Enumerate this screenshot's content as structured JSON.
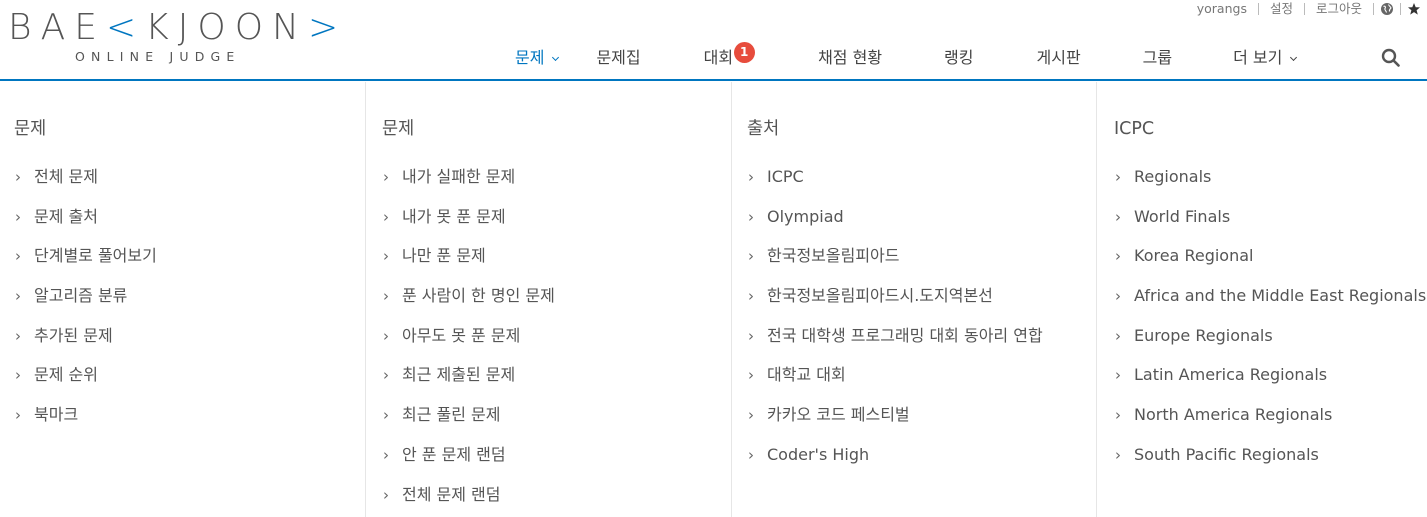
{
  "logo": {
    "top_left": "BAE",
    "top_mark": "K",
    "top_right": "JOON",
    "top_end": ">",
    "subtitle": "ONLINE JUDGE"
  },
  "topbar": {
    "username": "yorangs",
    "settings": "설정",
    "logout": "로그아웃",
    "globe_icon": "globe-icon",
    "star_icon": "star-icon"
  },
  "nav": {
    "items": [
      {
        "label": "문제",
        "active": true,
        "dropdown": true
      },
      {
        "label": "문제집"
      },
      {
        "label": "대회",
        "badge": "1"
      },
      {
        "label": "채점 현황"
      },
      {
        "label": "랭킹"
      },
      {
        "label": "게시판"
      },
      {
        "label": "그룹"
      },
      {
        "label": "더 보기",
        "dropdown": true
      }
    ],
    "search_icon": "search-icon"
  },
  "colors": {
    "accent": "#0076c0",
    "badge": "#e74c3c",
    "text": "#555555"
  },
  "mega_menu": {
    "columns": [
      {
        "title": "문제",
        "items": [
          "전체 문제",
          "문제 출처",
          "단계별로 풀어보기",
          "알고리즘 분류",
          "추가된 문제",
          "문제 순위",
          "북마크"
        ]
      },
      {
        "title": "문제",
        "items": [
          "내가 실패한 문제",
          "내가 못 푼 문제",
          "나만 푼 문제",
          "푼 사람이 한 명인 문제",
          "아무도 못 푼 문제",
          "최근 제출된 문제",
          "최근 풀린 문제",
          "안 푼 문제 랜덤",
          "전체 문제 랜덤"
        ]
      },
      {
        "title": "출처",
        "items": [
          "ICPC",
          "Olympiad",
          "한국정보올림피아드",
          "한국정보올림피아드시.도지역본선",
          "전국 대학생 프로그래밍 대회 동아리 연합",
          "대학교 대회",
          "카카오 코드 페스티벌",
          "Coder's High"
        ]
      },
      {
        "title": "ICPC",
        "items": [
          "Regionals",
          "World Finals",
          "Korea Regional",
          "Africa and the Middle East Regionals",
          "Europe Regionals",
          "Latin America Regionals",
          "North America Regionals",
          "South Pacific Regionals"
        ]
      }
    ],
    "chevron": "›"
  }
}
